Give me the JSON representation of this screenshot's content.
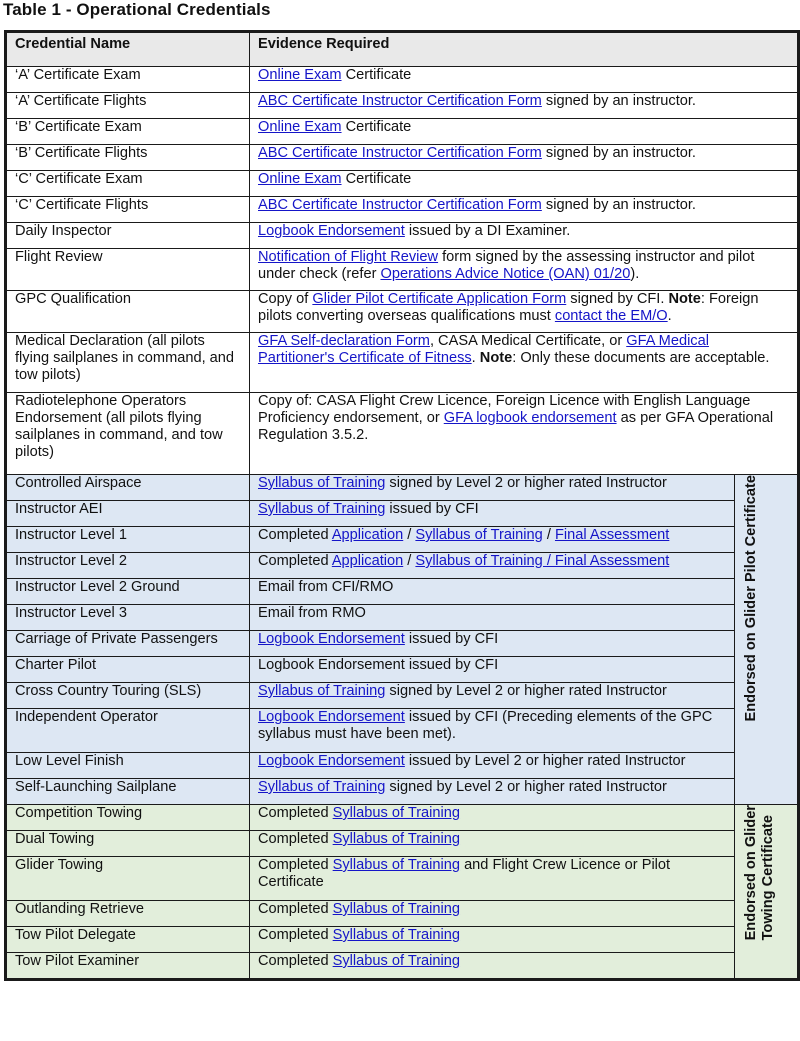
{
  "title": "Table 1 - Operational Credentials",
  "colors": {
    "link": "#1515c8",
    "header_bg": "#e9e9e9",
    "glider_pilot_bg": "#dde7f3",
    "towing_bg": "#e2eedb"
  },
  "headers": {
    "name": "Credential Name",
    "evidence": "Evidence Required"
  },
  "groups": {
    "glider_pilot": "Endorsed on Glider Pilot Certificate",
    "towing_line1": "Endorsed on Glider",
    "towing_line2": "Towing Certificate"
  },
  "rows": [
    {
      "name": "‘A’ Certificate Exam",
      "evidence": [
        {
          "link": "Online Exam"
        },
        {
          "text": " Certificate"
        }
      ]
    },
    {
      "name": "‘A’ Certificate Flights",
      "evidence": [
        {
          "link": "ABC Certificate Instructor Certification Form"
        },
        {
          "text": " signed by an instructor."
        },
        {
          "link": " "
        }
      ]
    },
    {
      "name": "‘B’ Certificate Exam",
      "evidence": [
        {
          "link": "Online Exam"
        },
        {
          "text": " Certificate"
        }
      ]
    },
    {
      "name": "‘B’ Certificate Flights",
      "evidence": [
        {
          "link": "ABC Certificate Instructor Certification Form"
        },
        {
          "text": " signed by an instructor."
        }
      ]
    },
    {
      "name": "‘C’ Certificate Exam",
      "evidence": [
        {
          "link": "Online Exam"
        },
        {
          "text": " Certificate"
        }
      ]
    },
    {
      "name": "‘C’ Certificate Flights",
      "evidence": [
        {
          "link": "ABC Certificate Instructor Certification Form"
        },
        {
          "text": " signed by an instructor."
        }
      ]
    },
    {
      "name": "Daily Inspector",
      "evidence": [
        {
          "link": "Logbook Endorsement"
        },
        {
          "text": " issued by a DI Examiner."
        }
      ]
    },
    {
      "name": "Flight Review",
      "evidence": [
        {
          "link": "Notification of Flight Review"
        },
        {
          "text": " form signed by the assessing instructor and pilot under check (refer "
        },
        {
          "link": "Operations Advice Notice (OAN) 01/20"
        },
        {
          "text": ")."
        }
      ]
    },
    {
      "name": "GPC Qualification",
      "evidence": [
        {
          "text": "Copy of "
        },
        {
          "link": "Glider Pilot Certificate Application Form"
        },
        {
          "text": " signed by CFI. "
        },
        {
          "bold": "Note"
        },
        {
          "text": ": Foreign pilots converting overseas qualifications must "
        },
        {
          "link": "contact the EM/O"
        },
        {
          "text": "."
        }
      ]
    },
    {
      "name": "Medical Declaration (all pilots flying sailplanes in command, and tow pilots)",
      "evidence": [
        {
          "link": "GFA Self-declaration Form"
        },
        {
          "text": ", CASA Medical Certificate, or "
        },
        {
          "link": "GFA Medical Partitioner's Certificate of Fitness"
        },
        {
          "text": ". "
        },
        {
          "bold": "Note"
        },
        {
          "text": ": Only these documents are acceptable."
        }
      ]
    },
    {
      "name": "Radiotelephone Operators Endorsement (all pilots flying sailplanes in command, and tow pilots)",
      "evidence": [
        {
          "text": "Copy of: CASA Flight Crew Licence, Foreign Licence with English Language Proficiency endorsement, or "
        },
        {
          "link": "GFA logbook endorsement"
        },
        {
          "text": " as per GFA Operational Regulation 3.5.2."
        }
      ]
    },
    {
      "group": "glider_pilot",
      "name": "Controlled Airspace",
      "evidence": [
        {
          "link": "Syllabus of Training"
        },
        {
          "text": " signed by Level 2 or higher rated Instructor"
        }
      ]
    },
    {
      "group": "glider_pilot",
      "name": "Instructor AEI",
      "evidence": [
        {
          "link": "Syllabus of Training"
        },
        {
          "text": " issued by CFI"
        }
      ]
    },
    {
      "group": "glider_pilot",
      "name": "Instructor Level 1",
      "evidence": [
        {
          "text": "Completed "
        },
        {
          "link": "Application"
        },
        {
          "text": " / "
        },
        {
          "link": "Syllabus of Training"
        },
        {
          "text": " / "
        },
        {
          "link": "Final Assessment"
        }
      ]
    },
    {
      "group": "glider_pilot",
      "name": "Instructor Level 2",
      "evidence": [
        {
          "text": "Completed "
        },
        {
          "link": "Application"
        },
        {
          "text": " / "
        },
        {
          "link": "Syllabus of Training / Final Assessment"
        }
      ]
    },
    {
      "group": "glider_pilot",
      "name": "Instructor Level 2 Ground",
      "evidence": [
        {
          "text": "Email from CFI/RMO"
        }
      ]
    },
    {
      "group": "glider_pilot",
      "name": "Instructor Level 3",
      "evidence": [
        {
          "text": "Email from RMO"
        }
      ]
    },
    {
      "group": "glider_pilot",
      "name": "Carriage of Private Passengers",
      "evidence": [
        {
          "link": "Logbook Endorsement"
        },
        {
          "text": " issued by CFI"
        }
      ]
    },
    {
      "group": "glider_pilot",
      "name": "Charter Pilot",
      "evidence": [
        {
          "text": "Logbook Endorsement issued by CFI"
        }
      ]
    },
    {
      "group": "glider_pilot",
      "name": "Cross Country Touring (SLS)",
      "evidence": [
        {
          "link": "Syllabus of Training"
        },
        {
          "text": " signed by Level 2 or higher rated Instructor"
        }
      ]
    },
    {
      "group": "glider_pilot",
      "name": "Independent Operator",
      "evidence": [
        {
          "link": "Logbook Endorsement"
        },
        {
          "text": " issued by CFI (Preceding elements of the GPC syllabus must have been met)."
        }
      ]
    },
    {
      "group": "glider_pilot",
      "name": "Low Level Finish",
      "evidence": [
        {
          "link": "Logbook Endorsement"
        },
        {
          "text": " issued by Level 2 or higher rated Instructor"
        }
      ]
    },
    {
      "group": "glider_pilot",
      "name": "Self-Launching Sailplane",
      "evidence": [
        {
          "link": "Syllabus of Training"
        },
        {
          "text": " signed by Level 2 or higher rated Instructor"
        }
      ]
    },
    {
      "group": "towing",
      "name": "Competition Towing",
      "evidence": [
        {
          "text": "Completed "
        },
        {
          "link": "Syllabus of Training"
        }
      ]
    },
    {
      "group": "towing",
      "name": "Dual Towing",
      "evidence": [
        {
          "text": "Completed "
        },
        {
          "link": "Syllabus of Training"
        }
      ]
    },
    {
      "group": "towing",
      "name": "Glider Towing",
      "evidence": [
        {
          "text": "Completed "
        },
        {
          "link": "Syllabus of Training"
        },
        {
          "text": " and Flight Crew Licence or Pilot Certificate"
        }
      ]
    },
    {
      "group": "towing",
      "name": "Outlanding Retrieve",
      "evidence": [
        {
          "text": "Completed "
        },
        {
          "link": "Syllabus of Training"
        }
      ]
    },
    {
      "group": "towing",
      "name": "Tow Pilot Delegate",
      "evidence": [
        {
          "text": "Completed "
        },
        {
          "link": "Syllabus of Training"
        }
      ]
    },
    {
      "group": "towing",
      "name": "Tow Pilot Examiner",
      "evidence": [
        {
          "text": "Completed "
        },
        {
          "link": "Syllabus of Training"
        }
      ]
    }
  ]
}
